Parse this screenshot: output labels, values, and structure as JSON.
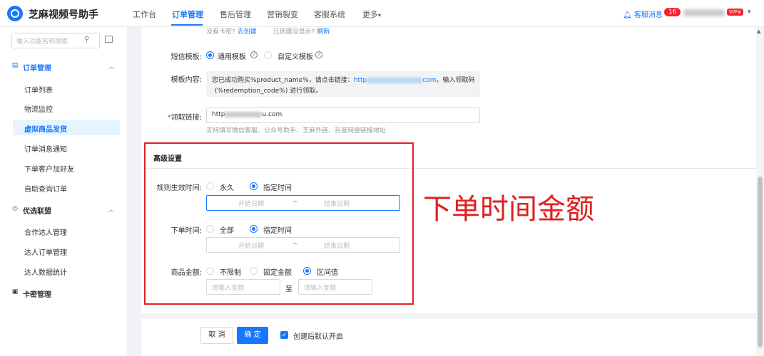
{
  "app": {
    "title": "芝麻视频号助手"
  },
  "nav": {
    "items": [
      "工作台",
      "订单管理",
      "售后管理",
      "营销裂变",
      "客服系统",
      "更多"
    ],
    "more_caret": "▾"
  },
  "header": {
    "service_label": "客服消息",
    "badge_count": "16",
    "vip_label": "VIP④",
    "caret": "▾"
  },
  "sidebar": {
    "search_placeholder": "输入功能名称搜索",
    "sections": [
      {
        "label": "订单管理",
        "items": [
          "订单列表",
          "物流监控",
          "虚拟商品发货",
          "订单消息通知",
          "下单客户加好友",
          "自助查询订单"
        ]
      },
      {
        "label": "优选联盟",
        "items": [
          "合作达人管理",
          "达人订单管理",
          "达人数据统计"
        ]
      },
      {
        "label": "卡密管理",
        "items": []
      }
    ]
  },
  "form": {
    "top_hint": {
      "text1": "没有卡密?",
      "link1": "去创建",
      "text2": "已创建没显示?",
      "link2": "刷新"
    },
    "sms_template": {
      "label": "短信模板:",
      "options": [
        "通用模板",
        "自定义模板"
      ]
    },
    "template_content": {
      "label": "模板内容:",
      "line1_prefix": "您已成功购买%product_name%，请点击链接：",
      "link_start": "http",
      "link_end": "com",
      "line1_suffix": "，输入领取码",
      "line2": "(%redemption_code%) 进行领取。"
    },
    "claim_link": {
      "label": "领取链接:",
      "value_start": "http",
      "value_end": "u.com",
      "help": "支持填写微信客服、公众号助手、芝麻外链、百度网盘链接地址"
    }
  },
  "advanced": {
    "title": "高级设置",
    "rule_time": {
      "label": "规则生效时间:",
      "options": [
        "永久",
        "指定时间"
      ],
      "start_placeholder": "开始日期",
      "sep": "~",
      "end_placeholder": "结束日期"
    },
    "order_time": {
      "label": "下单时间:",
      "options": [
        "全部",
        "指定时间"
      ],
      "start_placeholder": "开始日期",
      "sep": "~",
      "end_placeholder": "结束日期"
    },
    "amount": {
      "label": "商品金额:",
      "options": [
        "不限制",
        "固定金额",
        "区间值"
      ],
      "min_placeholder": "请输入金额",
      "to": "至",
      "max_placeholder": "请输入金额"
    }
  },
  "annotation": {
    "text": "下单时间金额"
  },
  "footer": {
    "cancel": "取 消",
    "confirm": "确 定",
    "default_on": "创建后默认开启"
  },
  "colors": {
    "accent": "#1677ff",
    "annotation_red": "#e02020"
  }
}
